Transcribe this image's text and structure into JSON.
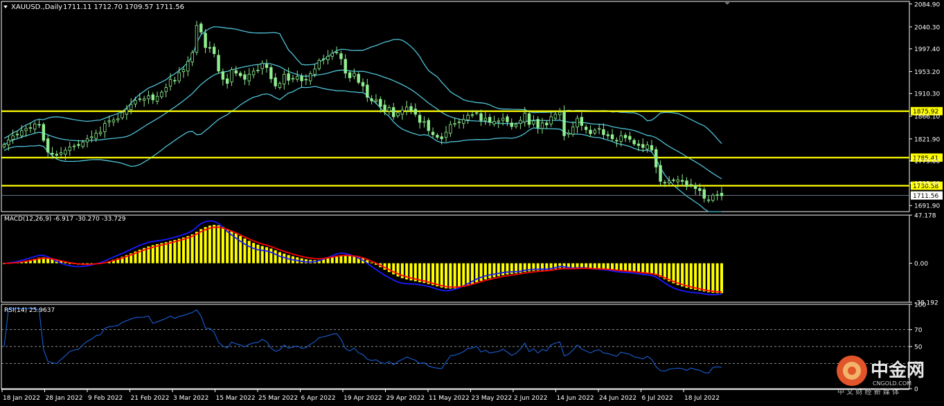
{
  "header": {
    "symbol": "XAUUSD.,Daily",
    "ohlc": "1711.11 1712.70 1709.57 1711.56"
  },
  "price_axis": {
    "ticks": [
      "2084.90",
      "2040.30",
      "1997.40",
      "1953.20",
      "1910.30",
      "1866.10",
      "1821.90",
      "1779.00",
      "1735.60",
      "1691.90"
    ]
  },
  "levels": [
    {
      "label": "1875.92",
      "value": 1875.92
    },
    {
      "label": "1785.41",
      "value": 1785.41
    },
    {
      "label": "1730.58",
      "value": 1730.58
    }
  ],
  "current_price": {
    "label": "1711.56",
    "value": 1711.56
  },
  "macd": {
    "title": "MACD(12,26,9) -6.917 -30.270 -33.729",
    "ticks": [
      "47.178",
      "0.00",
      "-38.192"
    ]
  },
  "rsi": {
    "title": "RSI(14) 25.9637",
    "ticks": [
      "100",
      "70",
      "50",
      "30",
      "0"
    ]
  },
  "x_axis": {
    "labels": [
      "18 Jan 2022",
      "28 Jan 2022",
      "9 Feb 2022",
      "21 Feb 2022",
      "3 Mar 2022",
      "15 Mar 2022",
      "25 Mar 2022",
      "6 Apr 2022",
      "19 Apr 2022",
      "29 Apr 2022",
      "11 May 2022",
      "23 May 2022",
      "2 Jun 2022",
      "14 Jun 2022",
      "24 Jun 2022",
      "6 Jul 2022",
      "18 Jul 2022"
    ]
  },
  "watermark": {
    "brand": "中金网",
    "domain": "CNGOLD.COM",
    "tagline": "中 文 财 经 新 媒 体"
  },
  "colors": {
    "bg": "#000000",
    "axis": "#ffffff",
    "candle": "#90ee90",
    "band": "#4fc3d9",
    "level": "#ffff00",
    "macd_hist": "#ffff00",
    "macd_line": "#1a1aff",
    "signal_line": "#ff0000",
    "rsi_line": "#1a5fd6"
  },
  "chart_data": {
    "type": "candlestick",
    "title": "XAUUSD.,Daily",
    "ylim": [
      1680,
      2090
    ],
    "price_grid_ticks": [
      2084.9,
      2040.3,
      1997.4,
      1953.2,
      1910.3,
      1866.1,
      1821.9,
      1779.0,
      1735.6,
      1691.9
    ],
    "candles_close": [
      1811,
      1820,
      1828,
      1830,
      1838,
      1842,
      1844,
      1851,
      1849,
      1819,
      1796,
      1792,
      1790,
      1795,
      1800,
      1806,
      1808,
      1809,
      1816,
      1822,
      1826,
      1833,
      1835,
      1852,
      1857,
      1859,
      1861,
      1873,
      1880,
      1889,
      1897,
      1899,
      1900,
      1906,
      1898,
      1905,
      1913,
      1922,
      1938,
      1935,
      1951,
      1957,
      1973,
      1990,
      2043,
      2030,
      2000,
      1999,
      1988,
      1954,
      1938,
      1930,
      1957,
      1950,
      1945,
      1938,
      1948,
      1954,
      1956,
      1969,
      1961,
      1939,
      1925,
      1930,
      1948,
      1936,
      1940,
      1944,
      1935,
      1938,
      1949,
      1958,
      1975,
      1978,
      1983,
      1989,
      1991,
      1978,
      1950,
      1941,
      1950,
      1932,
      1925,
      1903,
      1896,
      1898,
      1885,
      1878,
      1883,
      1865,
      1873,
      1878,
      1884,
      1877,
      1870,
      1854,
      1856,
      1838,
      1830,
      1825,
      1822,
      1835,
      1850,
      1852,
      1855,
      1860,
      1868,
      1869,
      1873,
      1858,
      1862,
      1854,
      1856,
      1857,
      1862,
      1855,
      1846,
      1850,
      1858,
      1872,
      1850,
      1857,
      1844,
      1853,
      1849,
      1865,
      1870,
      1874,
      1828,
      1833,
      1845,
      1862,
      1848,
      1840,
      1832,
      1839,
      1842,
      1830,
      1828,
      1822,
      1818,
      1828,
      1824,
      1821,
      1812,
      1809,
      1805,
      1810,
      1800,
      1767,
      1739,
      1736,
      1740,
      1741,
      1742,
      1739,
      1729,
      1733,
      1725,
      1721,
      1706,
      1703,
      1712,
      1713,
      1711
    ],
    "levels": [
      1875.92,
      1785.41,
      1730.58
    ],
    "current_price": 1711.56,
    "macd_panel": {
      "ylim": [
        -38.192,
        47.178
      ],
      "signal_last": -30.27,
      "macd_last": -33.729,
      "hist_last": -6.917
    },
    "rsi_panel": {
      "ylim": [
        0,
        100
      ],
      "levels": [
        70,
        50,
        30
      ],
      "last": 25.9637
    },
    "x_labels": [
      "18 Jan 2022",
      "28 Jan 2022",
      "9 Feb 2022",
      "21 Feb 2022",
      "3 Mar 2022",
      "15 Mar 2022",
      "25 Mar 2022",
      "6 Apr 2022",
      "19 Apr 2022",
      "29 Apr 2022",
      "11 May 2022",
      "23 May 2022",
      "2 Jun 2022",
      "14 Jun 2022",
      "24 Jun 2022",
      "6 Jul 2022",
      "18 Jul 2022"
    ]
  }
}
